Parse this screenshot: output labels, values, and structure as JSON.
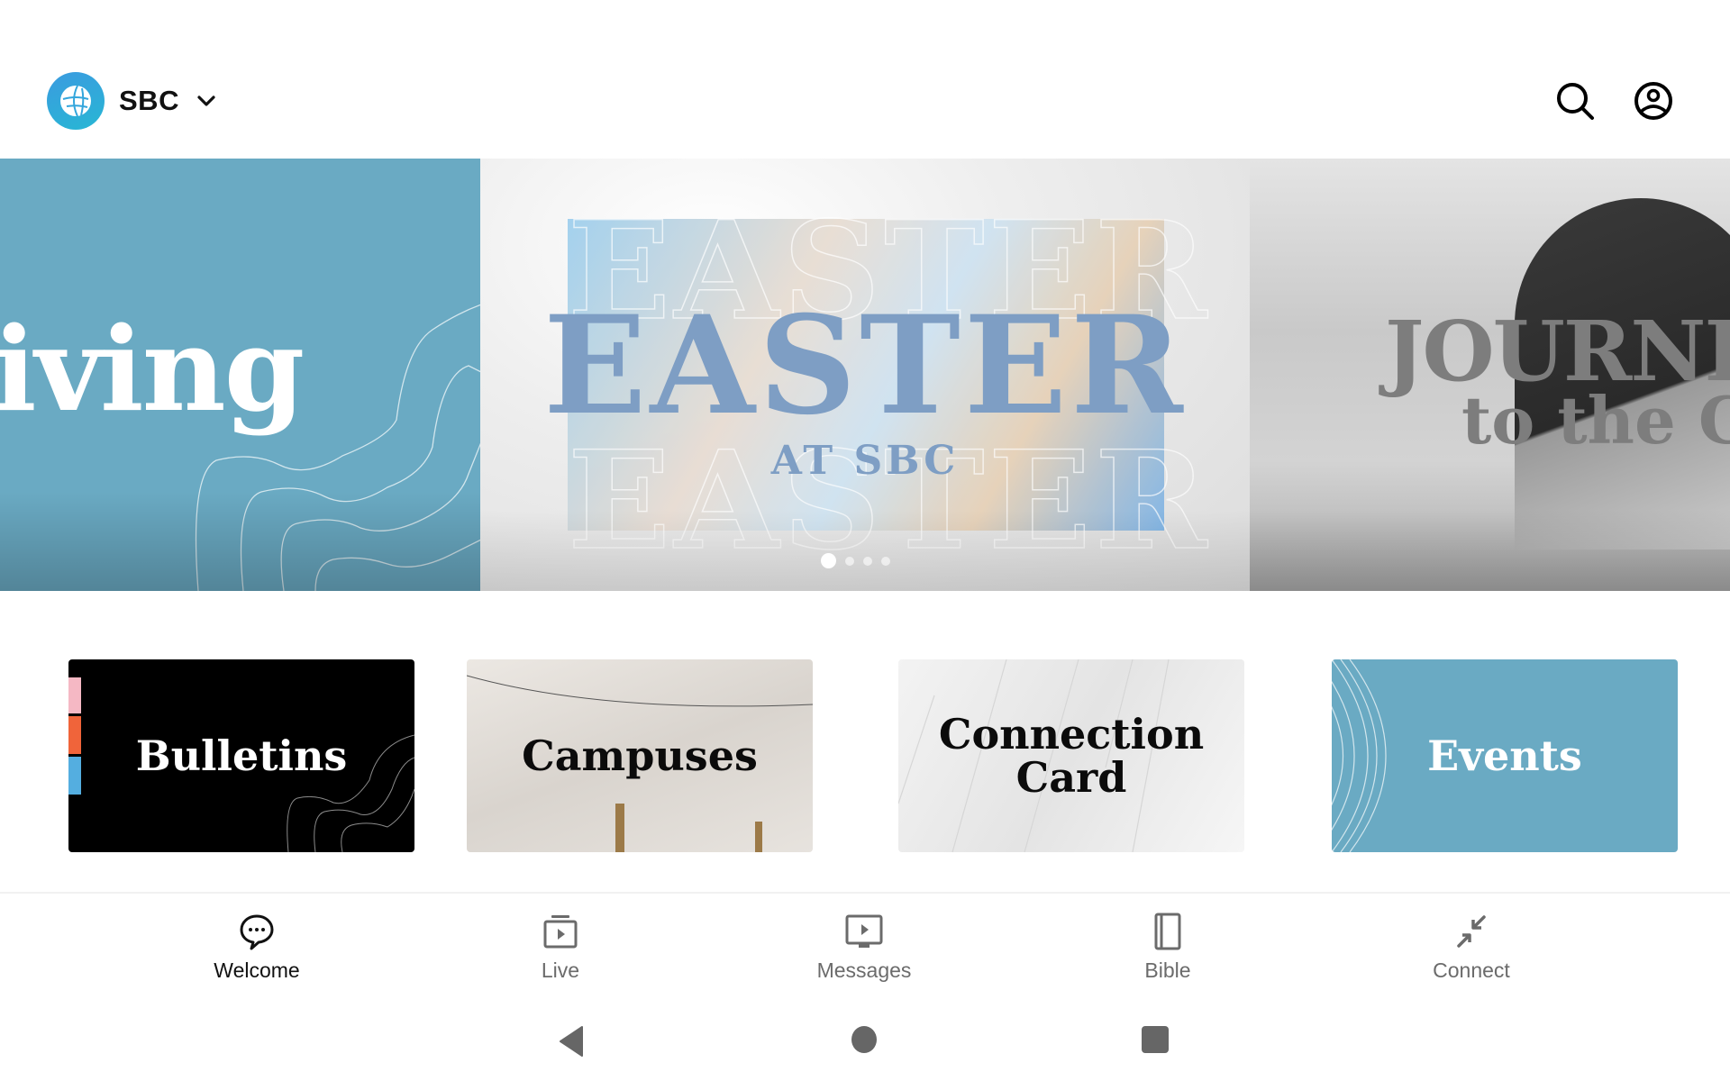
{
  "header": {
    "brand_name": "SBC",
    "brand_icon": "globe-icon",
    "dropdown_icon": "chevron-down-icon",
    "actions": [
      {
        "name": "search",
        "icon": "search-icon"
      },
      {
        "name": "profile",
        "icon": "account-circle-icon"
      }
    ]
  },
  "carousel": {
    "slides": [
      {
        "id": "giving",
        "title": "iving"
      },
      {
        "id": "easter",
        "title": "EASTER",
        "subtitle": "AT SBC"
      },
      {
        "id": "journey",
        "line1": "JOURNEY",
        "line2": "to the CR"
      }
    ],
    "page_count": 4,
    "active_index": 0
  },
  "tiles": [
    {
      "label": "Bulletins"
    },
    {
      "label": "Campuses"
    },
    {
      "label": "Connection Card"
    },
    {
      "label": "Events"
    }
  ],
  "colors": {
    "accent_blue": "#6aaac3",
    "nav_active": "#111111",
    "nav_inactive": "#6b6b6b"
  },
  "bottom_nav": {
    "active": "Welcome",
    "items": [
      {
        "label": "Welcome",
        "icon": "chat-bubble-icon"
      },
      {
        "label": "Live",
        "icon": "live-tv-icon"
      },
      {
        "label": "Messages",
        "icon": "video-screen-icon"
      },
      {
        "label": "Bible",
        "icon": "book-icon"
      },
      {
        "label": "Connect",
        "icon": "connect-arrows-icon"
      }
    ]
  },
  "system_nav": {
    "buttons": [
      "back",
      "home",
      "recents"
    ]
  }
}
